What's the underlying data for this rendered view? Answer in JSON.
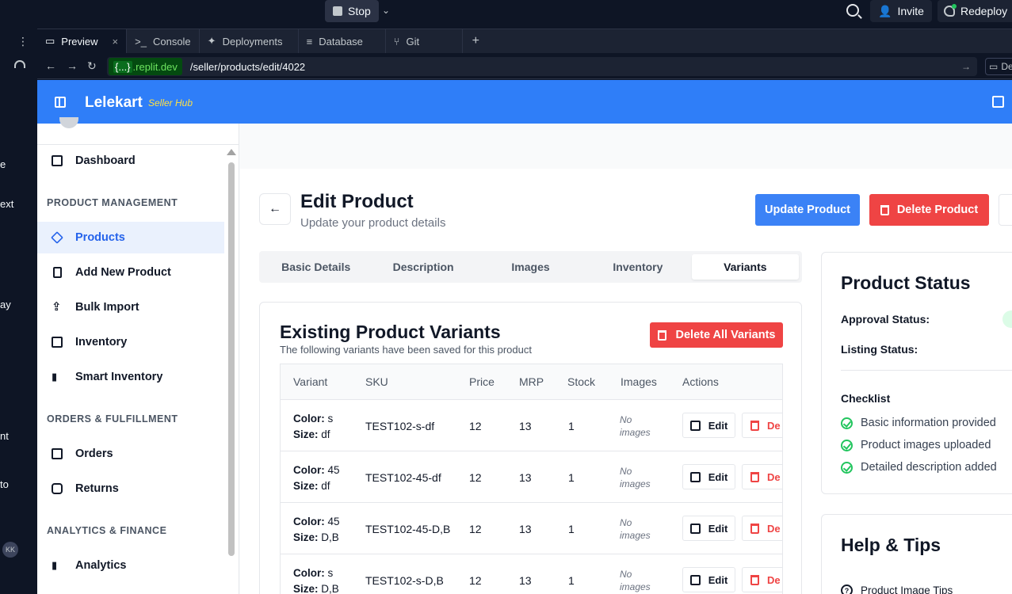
{
  "replit": {
    "stop_label": "Stop",
    "invite_label": "Invite",
    "redeploy_label": "Redeploy",
    "tabs": [
      {
        "label": "Preview",
        "icon": "monitor-icon"
      },
      {
        "label": "Console",
        "icon": "terminal-icon"
      },
      {
        "label": "Deployments",
        "icon": "rocket-icon"
      },
      {
        "label": "Database",
        "icon": "database-icon"
      },
      {
        "label": "Git",
        "icon": "git-icon"
      }
    ],
    "tab_prefixes": {
      "console": ">_"
    },
    "url_domain_brace": "{...}",
    "url_domain": ".replit.dev",
    "url_path": "/seller/products/edit/4022",
    "devtools_label": "De",
    "avatar_initials": "KK",
    "left_fragments": [
      "e",
      "ext",
      "ay",
      "nt",
      "to"
    ]
  },
  "app": {
    "brand": "Lelekart",
    "brand_sub": "Seller Hub",
    "sidebar": {
      "items": [
        {
          "label": "Dashboard",
          "icon": "grid-icon"
        },
        {
          "label": "Products",
          "icon": "layers-icon",
          "active": true
        },
        {
          "label": "Add New Product",
          "icon": "bookmark-icon"
        },
        {
          "label": "Bulk Import",
          "icon": "upload-icon"
        },
        {
          "label": "Inventory",
          "icon": "box-icon"
        },
        {
          "label": "Smart Inventory",
          "icon": "bar-chart-icon"
        },
        {
          "label": "Orders",
          "icon": "shopping-bag-icon"
        },
        {
          "label": "Returns",
          "icon": "package-icon"
        },
        {
          "label": "Analytics",
          "icon": "bar-chart-icon"
        }
      ],
      "sections": [
        "PRODUCT MANAGEMENT",
        "ORDERS & FULFILLMENT",
        "ANALYTICS & FINANCE"
      ]
    },
    "page": {
      "title": "Edit Product",
      "subtitle": "Update your product details",
      "update_label": "Update Product",
      "delete_label": "Delete Product"
    },
    "tabs": [
      "Basic Details",
      "Description",
      "Images",
      "Inventory",
      "Variants"
    ],
    "active_tab": "Variants",
    "variants": {
      "title": "Existing Product Variants",
      "subtitle": "The following variants have been saved for this product",
      "delete_all_label": "Delete All Variants",
      "columns": [
        "Variant",
        "SKU",
        "Price",
        "MRP",
        "Stock",
        "Images",
        "Actions"
      ],
      "color_label": "Color:",
      "size_label": "Size:",
      "rows": [
        {
          "color": "s",
          "size": "df",
          "sku": "TEST102-s-df",
          "price": "12",
          "mrp": "13",
          "stock": "1",
          "images_l1": "No",
          "images_l2": "images",
          "edit": "Edit",
          "delete": "De"
        },
        {
          "color": "45",
          "size": "df",
          "sku": "TEST102-45-df",
          "price": "12",
          "mrp": "13",
          "stock": "1",
          "images_l1": "No",
          "images_l2": "images",
          "edit": "Edit",
          "delete": "De"
        },
        {
          "color": "45",
          "size": "D,B",
          "sku": "TEST102-45-D,B",
          "price": "12",
          "mrp": "13",
          "stock": "1",
          "images_l1": "No",
          "images_l2": "images",
          "edit": "Edit",
          "delete": "De"
        },
        {
          "color": "s",
          "size": "D,B",
          "sku": "TEST102-s-D,B",
          "price": "12",
          "mrp": "13",
          "stock": "1",
          "images_l1": "No",
          "images_l2": "images",
          "edit": "Edit",
          "delete": "De"
        }
      ]
    },
    "status": {
      "title": "Product Status",
      "approval_label": "Approval Status:",
      "listing_label": "Listing Status:",
      "checklist_title": "Checklist",
      "checklist": [
        "Basic information provided",
        "Product images uploaded",
        "Detailed description added"
      ]
    },
    "help": {
      "title": "Help & Tips",
      "item": "Product Image Tips",
      "item_icon_glyph": "?"
    }
  },
  "colors": {
    "header_blue": "#2f7ef8",
    "primary": "#3b82f6",
    "danger": "#ef4444",
    "success": "#22c55e",
    "brand_sub": "#fde047"
  }
}
